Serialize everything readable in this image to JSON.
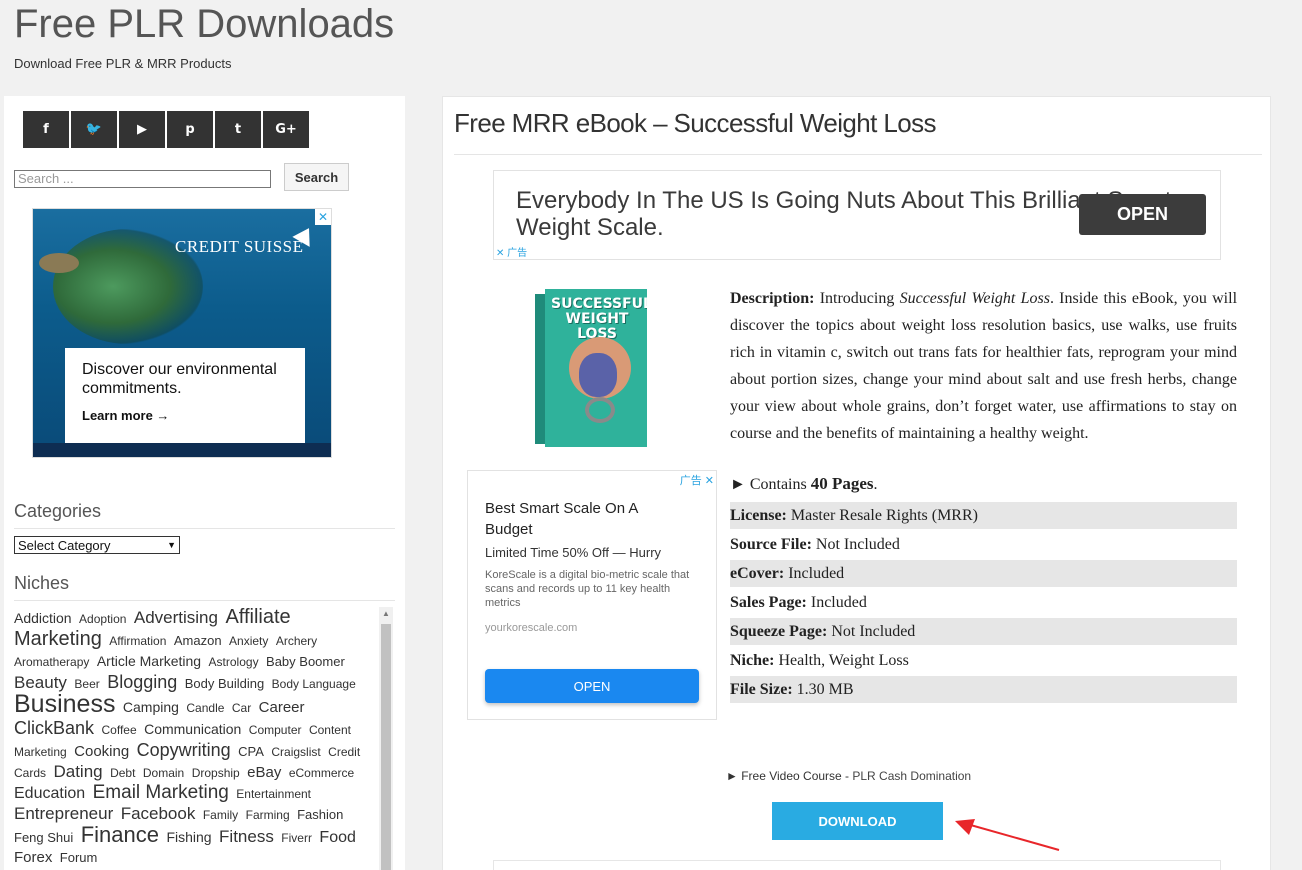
{
  "site": {
    "title": "Free PLR Downloads",
    "tagline": "Download Free PLR & MRR Products"
  },
  "sidebar": {
    "social_icons": [
      {
        "name": "facebook-icon",
        "glyph": "f"
      },
      {
        "name": "twitter-icon",
        "glyph": "🐦"
      },
      {
        "name": "youtube-icon",
        "glyph": "▶"
      },
      {
        "name": "pinterest-icon",
        "glyph": "p"
      },
      {
        "name": "tumblr-icon",
        "glyph": "t"
      },
      {
        "name": "google-plus-icon",
        "glyph": "G+"
      }
    ],
    "search": {
      "placeholder": "Search ...",
      "button": "Search"
    },
    "ad": {
      "brand": "CREDIT SUISSE",
      "text": "Discover our environmental commitments.",
      "cta": "Learn more →",
      "close": "✕"
    },
    "categories_title": "Categories",
    "category_select": "Select Category",
    "niches_title": "Niches",
    "tags": [
      {
        "t": "Addiction",
        "s": 14
      },
      {
        "t": "Adoption",
        "s": 12
      },
      {
        "t": "Advertising",
        "s": 17
      },
      {
        "t": "Affiliate Marketing",
        "s": 20
      },
      {
        "t": "Affirmation",
        "s": 12
      },
      {
        "t": "Amazon",
        "s": 13
      },
      {
        "t": "Anxiety",
        "s": 12
      },
      {
        "t": "Archery",
        "s": 12
      },
      {
        "t": "Aromatherapy",
        "s": 12
      },
      {
        "t": "Article Marketing",
        "s": 14
      },
      {
        "t": "Astrology",
        "s": 12
      },
      {
        "t": "Baby Boomer",
        "s": 13
      },
      {
        "t": "Beauty",
        "s": 17
      },
      {
        "t": "Beer",
        "s": 12
      },
      {
        "t": "Blogging",
        "s": 18
      },
      {
        "t": "Body Building",
        "s": 13
      },
      {
        "t": "Body Language",
        "s": 12
      },
      {
        "t": "Business",
        "s": 25
      },
      {
        "t": "Camping",
        "s": 14
      },
      {
        "t": "Candle",
        "s": 12
      },
      {
        "t": "Car",
        "s": 12
      },
      {
        "t": "Career",
        "s": 15
      },
      {
        "t": "ClickBank",
        "s": 18
      },
      {
        "t": "Coffee",
        "s": 12
      },
      {
        "t": "Communication",
        "s": 14
      },
      {
        "t": "Computer",
        "s": 12
      },
      {
        "t": "Content Marketing",
        "s": 12
      },
      {
        "t": "Cooking",
        "s": 15
      },
      {
        "t": "Copywriting",
        "s": 18
      },
      {
        "t": "CPA",
        "s": 13
      },
      {
        "t": "Craigslist",
        "s": 12
      },
      {
        "t": "Credit Cards",
        "s": 12
      },
      {
        "t": "Dating",
        "s": 17
      },
      {
        "t": "Debt",
        "s": 12
      },
      {
        "t": "Domain",
        "s": 12
      },
      {
        "t": "Dropship",
        "s": 12
      },
      {
        "t": "eBay",
        "s": 15
      },
      {
        "t": "eCommerce",
        "s": 12
      },
      {
        "t": "Education",
        "s": 16
      },
      {
        "t": "Email Marketing",
        "s": 19
      },
      {
        "t": "Entertainment",
        "s": 12
      },
      {
        "t": "Entrepreneur",
        "s": 17
      },
      {
        "t": "Facebook",
        "s": 17
      },
      {
        "t": "Family",
        "s": 12
      },
      {
        "t": "Farming",
        "s": 12
      },
      {
        "t": "Fashion",
        "s": 13
      },
      {
        "t": "Feng Shui",
        "s": 13
      },
      {
        "t": "Finance",
        "s": 22
      },
      {
        "t": "Fishing",
        "s": 14
      },
      {
        "t": "Fitness",
        "s": 17
      },
      {
        "t": "Fiverr",
        "s": 12
      },
      {
        "t": "Food",
        "s": 16
      },
      {
        "t": "Forex",
        "s": 15
      },
      {
        "t": "Forum",
        "s": 13
      }
    ]
  },
  "post": {
    "title": "Free MRR eBook – Successful Weight Loss",
    "top_ad": {
      "text": "Everybody In The US Is Going Nuts About This Brilliant Smart Weight Scale.",
      "button": "OPEN",
      "adchoice": "✕ 广告"
    },
    "cover_title": "SUCCESSFUL WEIGHT LOSS",
    "mid_ad": {
      "adchoice": "广告 ✕",
      "headline": "Best Smart Scale On A Budget",
      "subline": "Limited Time 50% Off — Hurry",
      "desc": "KoreScale is a digital bio-metric scale that scans and records up to 11 key health metrics",
      "domain": "yourkorescale.com",
      "button": "OPEN"
    },
    "description_label": "Description:",
    "description_intro": "Introducing",
    "description_title": "Successful Weight Loss",
    "description_rest": ". Inside this eBook, you will discover the topics about weight loss resolution basics, use walks, use fruits rich in vitamin c, switch out trans fats for healthier fats, reprogram your mind about portion sizes, change your mind about salt and use fresh herbs, change your view about whole grains, don’t forget water, use affirmations to stay on course and the benefits of maintaining a healthy weight.",
    "contains_prefix": "► Contains",
    "contains_pages": "40 Pages",
    "contains_suffix": ".",
    "specs": [
      {
        "label": "License:",
        "value": "Master Resale Rights (MRR)"
      },
      {
        "label": "Source File:",
        "value": "Not Included"
      },
      {
        "label": "eCover:",
        "value": "Included"
      },
      {
        "label": "Sales Page:",
        "value": "Included"
      },
      {
        "label": "Squeeze Page:",
        "value": "Not Included"
      },
      {
        "label": "Niche:",
        "value": "Health, Weight Loss"
      },
      {
        "label": "File Size:",
        "value": "1.30 MB"
      }
    ],
    "video_prefix": "► Free Video Course - ",
    "video_link": "PLR Cash Domination",
    "download_button": "DOWNLOAD"
  }
}
